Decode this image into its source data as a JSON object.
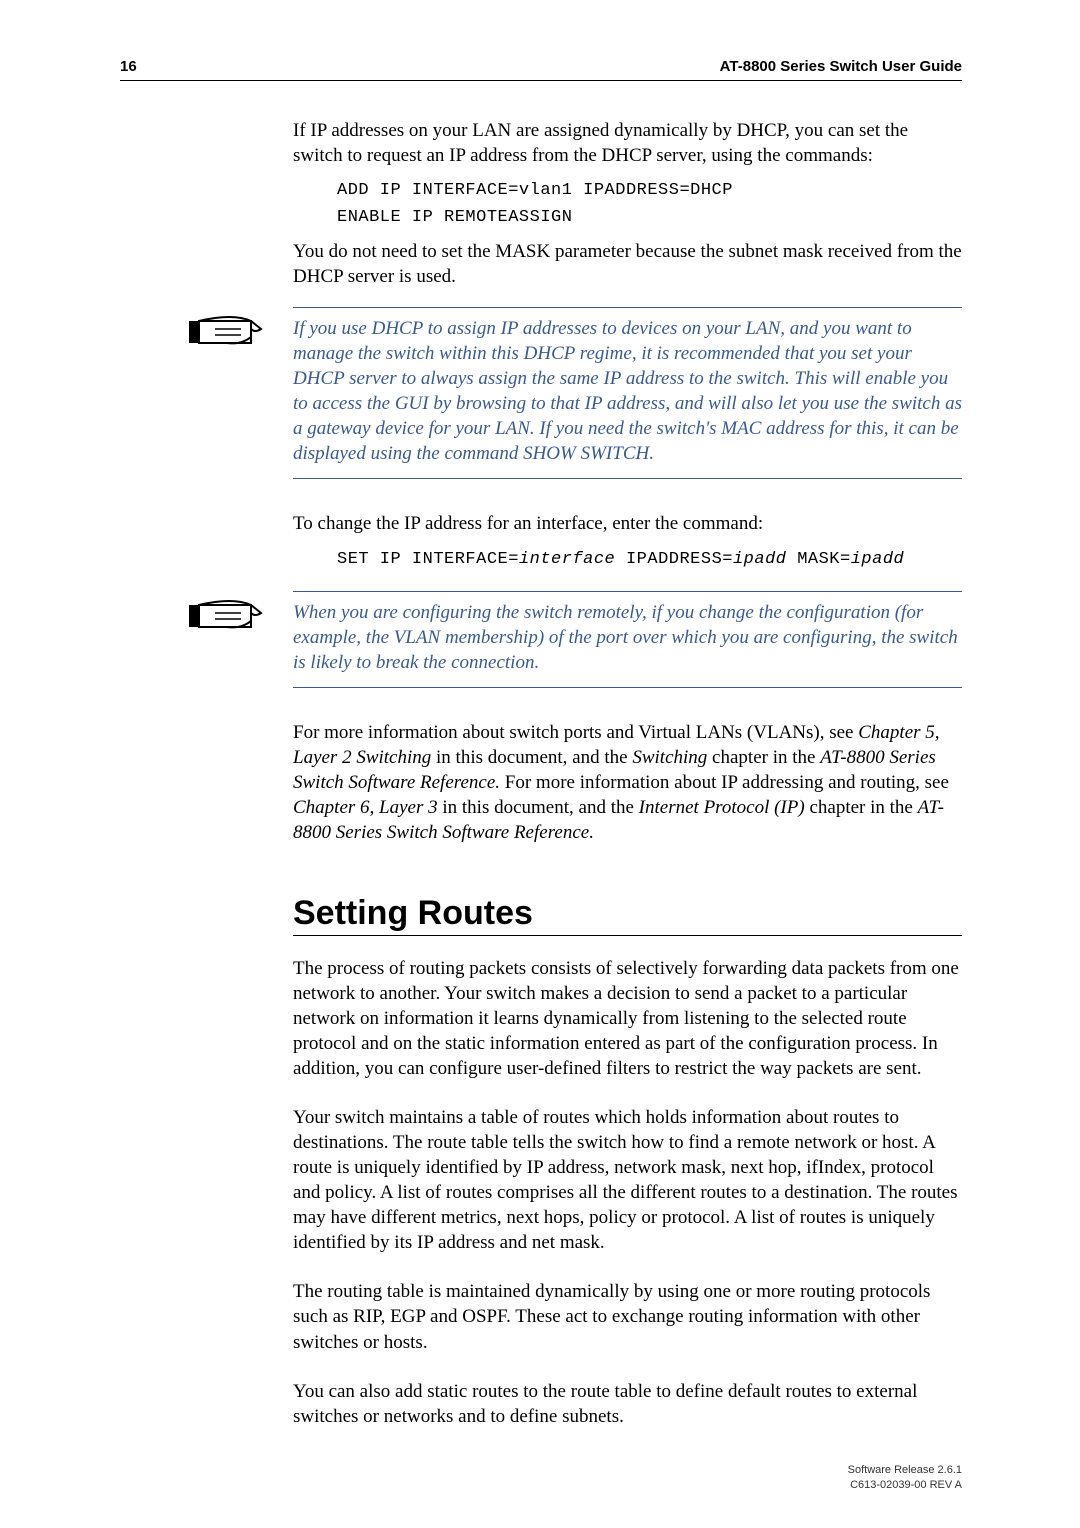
{
  "header": {
    "page_number": "16",
    "title": "AT-8800 Series Switch User Guide"
  },
  "body": {
    "p1": "If IP addresses on your LAN are assigned dynamically by DHCP, you can set the switch to request an IP address from the DHCP server, using the commands:",
    "code1_line1": "ADD IP INTERFACE=vlan1 IPADDRESS=DHCP",
    "code1_line2": "ENABLE IP REMOTEASSIGN",
    "p2": "You do not need to set the MASK parameter because the subnet mask received from the DHCP server is used.",
    "note1": "If you use DHCP to assign IP addresses to devices on your LAN, and you want to manage the switch within this DHCP regime, it is recommended that you set your DHCP server to always assign the same IP address to the switch. This will enable you to access the GUI by browsing to that IP address, and will also let you use the switch as a gateway device for your LAN. If you need the switch's MAC address for this, it can be displayed using the command SHOW SWITCH.",
    "p3": "To change the IP address for an interface, enter the command:",
    "code2_prefix": "SET IP INTERFACE=",
    "code2_var1": "interface",
    "code2_mid": " IPADDRESS=",
    "code2_var2": "ipadd",
    "code2_mid2": " MASK=",
    "code2_var3": "ipadd",
    "note2": "When you are configuring the switch remotely, if you change the configuration (for example, the VLAN membership) of the port over which you are configuring, the switch is likely to break the connection.",
    "p4_a": "For more information about switch ports and Virtual LANs (VLANs), see ",
    "p4_b": "Chapter 5, Layer 2 Switching",
    "p4_c": " in this document, and the ",
    "p4_d": "Switching",
    "p4_e": " chapter in the ",
    "p4_f": "AT-8800 Series Switch Software Reference.",
    "p4_g": " For more information about IP addressing and routing, see ",
    "p4_h": "Chapter 6, Layer 3",
    "p4_i": " in this document, and the ",
    "p4_j": "Internet Protocol (IP)",
    "p4_k": " chapter in the ",
    "p4_l": "AT-8800 Series Switch Software Reference.",
    "heading": "Setting Routes",
    "p5": "The process of routing packets consists of selectively forwarding data packets from one network to another. Your switch makes a decision to send a packet to a particular network on information it learns dynamically from listening to the selected route protocol and on the static information entered as part of the configuration process. In addition, you can configure user-defined filters to restrict the way packets are sent.",
    "p6": "Your switch maintains a table of routes which holds information about routes to destinations. The route table tells the switch how to find a remote network or host. A route is uniquely identified by IP address, network mask, next hop, ifIndex, protocol and policy. A list of routes comprises all the different routes to a destination. The routes may have different metrics, next hops, policy or protocol. A list of routes is uniquely identified by its IP address and net mask.",
    "p7": "The routing table is maintained dynamically by using one or more routing protocols such as RIP, EGP and OSPF. These act to exchange routing information with other switches or hosts.",
    "p8": "You can also add static routes to the route table to define default routes to external switches or networks and to define subnets."
  },
  "footer": {
    "line1": "Software Release 2.6.1",
    "line2": "C613-02039-00 REV A"
  }
}
